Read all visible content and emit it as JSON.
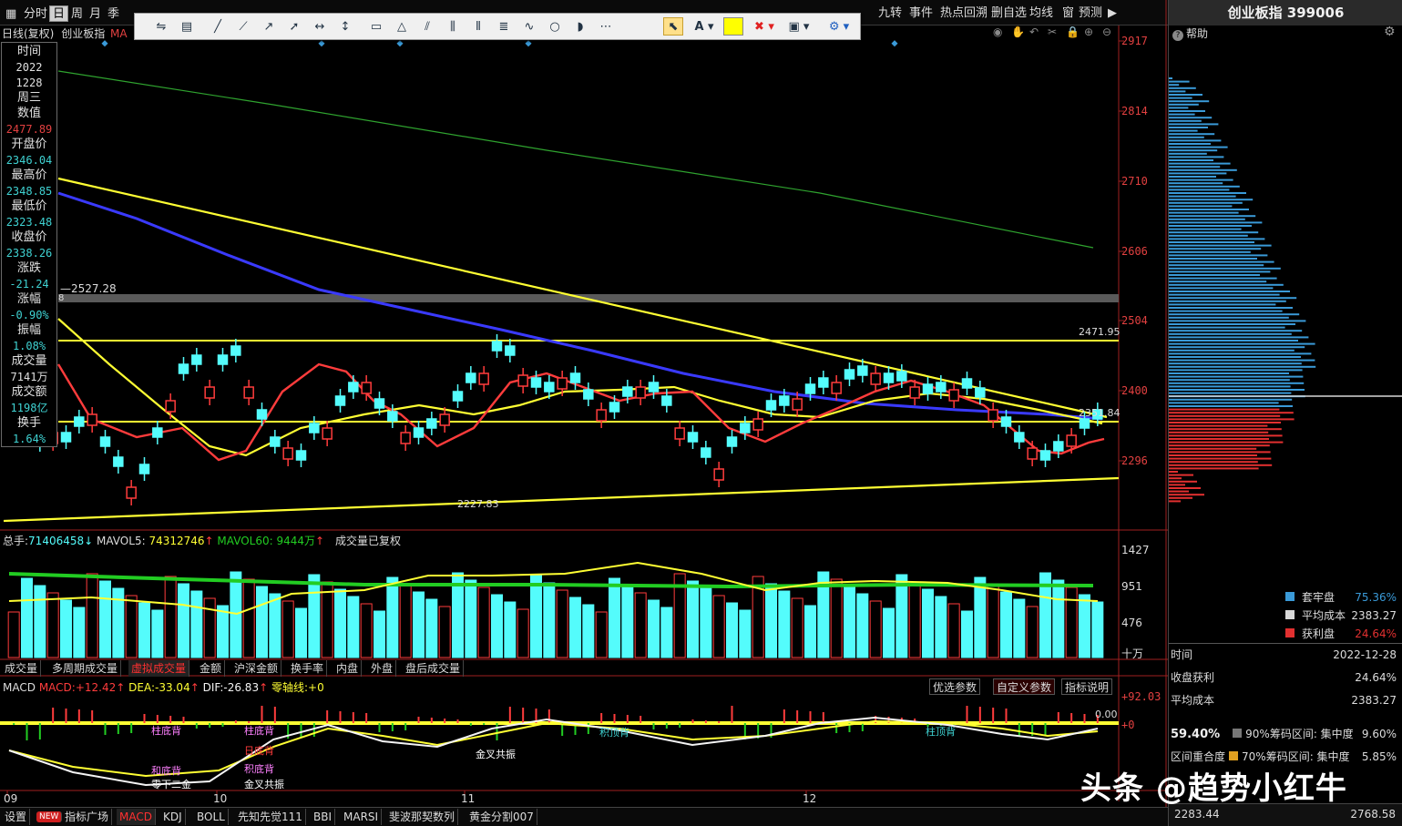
{
  "top_tabs": [
    {
      "label": "分时",
      "active": false
    },
    {
      "label": "日",
      "active": true
    },
    {
      "label": "周",
      "active": false
    },
    {
      "label": "月",
      "active": false
    },
    {
      "label": "季",
      "active": false
    }
  ],
  "right_tabs": [
    "九转",
    "事件",
    "热点回溯",
    "删自选",
    "均线",
    "窗",
    "预测"
  ],
  "chart_header": {
    "label": "日线(复权)",
    "security": "创业板指",
    "ma_tag": "MA"
  },
  "info_panel": [
    {
      "label": "时间",
      "value": "2022",
      "value2": "1228",
      "value3": "周三",
      "color": "#e0e0e0"
    },
    {
      "label": "数值",
      "value": "2477.89",
      "color": "#e24040"
    },
    {
      "label": "开盘价",
      "value": "2346.04",
      "color": "#3fd2d2"
    },
    {
      "label": "最高价",
      "value": "2348.85",
      "color": "#3fd2d2"
    },
    {
      "label": "最低价",
      "value": "2323.48",
      "color": "#3fd2d2"
    },
    {
      "label": "收盘价",
      "value": "2338.26",
      "color": "#3fd2d2"
    },
    {
      "label": "涨跌",
      "value": "-21.24",
      "color": "#3fd2d2"
    },
    {
      "label": "涨幅",
      "value": "-0.90%",
      "color": "#3fd2d2"
    },
    {
      "label": "振幅",
      "value": "1.08%",
      "color": "#3fd2d2"
    },
    {
      "label": "成交量",
      "value": "7141万",
      "color": "#e0e0e0"
    },
    {
      "label": "成交额",
      "value": "1198亿",
      "color": "#3fd2d2"
    },
    {
      "label": "换手",
      "value": "1.64%",
      "color": "#3fd2d2"
    }
  ],
  "price_axis": [
    "2917",
    "2814",
    "2710",
    "2606",
    "2504",
    "2400",
    "2296"
  ],
  "price_marks": {
    "cursor_price": "2527.28",
    "cursor_row": "8",
    "high_line": "2471.95",
    "mid_line": "2351.84",
    "low_label": "2227.83"
  },
  "volume_header": {
    "total_label": "总手:",
    "total": "71406458",
    "total_arrow": "↓",
    "mavol5_label": "MAVOL5:",
    "mavol5": "74312746",
    "mavol5_arrow": "↑",
    "mavol60_label": "MAVOL60:",
    "mavol60": "9444万",
    "mavol60_arrow": "↑",
    "note": "成交量已复权"
  },
  "volume_axis": [
    "1427",
    "951",
    "476",
    "十万"
  ],
  "volume_tabs": [
    "成交量",
    "多周期成交量",
    "虚拟成交量",
    "金额",
    "沪深金额",
    "换手率",
    "内盘",
    "外盘",
    "盘后成交量"
  ],
  "volume_tab_active": "虚拟成交量",
  "macd_header": {
    "name": "MACD",
    "macd_label": "MACD:",
    "macd": "+12.42",
    "macd_arrow": "↑",
    "dea_label": "DEA:",
    "dea": "-33.04",
    "dea_arrow": "↑",
    "dif_label": "DIF:",
    "dif": "-26.83",
    "dif_arrow": "↑",
    "zero_label": "零轴线:",
    "zero": "+0"
  },
  "macd_buttons": [
    "优选参数",
    "自定义参数",
    "指标说明"
  ],
  "macd_axis": [
    "+92.03",
    "0.00",
    "+0"
  ],
  "macd_annotations": [
    "柱底背",
    "柱底背",
    "日底背",
    "积底背",
    "零下二金",
    "和底背",
    "金叉共振",
    "金叉共振",
    "积顶背",
    "柱顶背"
  ],
  "x_axis": [
    "09",
    "10",
    "11",
    "12"
  ],
  "bottom_tabs": [
    "设置",
    "NEW",
    "指标广场",
    "MACD",
    "KDJ",
    "BOLL",
    "先知先觉111",
    "BBI",
    "MARSI",
    "斐波那契数列",
    "黄金分割007"
  ],
  "bottom_tab_active": "MACD",
  "right_panel": {
    "title": "创业板指 399006",
    "help": "帮助",
    "legend": [
      {
        "label": "套牢盘",
        "value": "75.36%",
        "color": "#3a9ad8"
      },
      {
        "label": "平均成本",
        "value": "2383.27",
        "color": "#d8d8d8"
      },
      {
        "label": "获利盘",
        "value": "24.64%",
        "color": "#e23030"
      }
    ],
    "time_label": "时间",
    "time": "2022-12-28",
    "profit_label": "收盘获利",
    "profit": "24.64%",
    "avg_label": "平均成本",
    "avg": "2383.27",
    "concentration": "59.40%",
    "c90_label": "90%筹码区间: 集中度",
    "c90": "9.60%",
    "overlap_label": "区间重合度",
    "c70_label": "70%筹码区间: 集中度",
    "c70": "5.85%",
    "low_price": "2283.44",
    "high_price": "2768.58"
  },
  "watermark": "头条 @趋势小红牛",
  "colors": {
    "up": "#ff3c3c",
    "down": "#54fcfc",
    "ma_yellow": "#ffff33",
    "ma_blue": "#3a3aff",
    "ma_green": "#2fa32f"
  }
}
